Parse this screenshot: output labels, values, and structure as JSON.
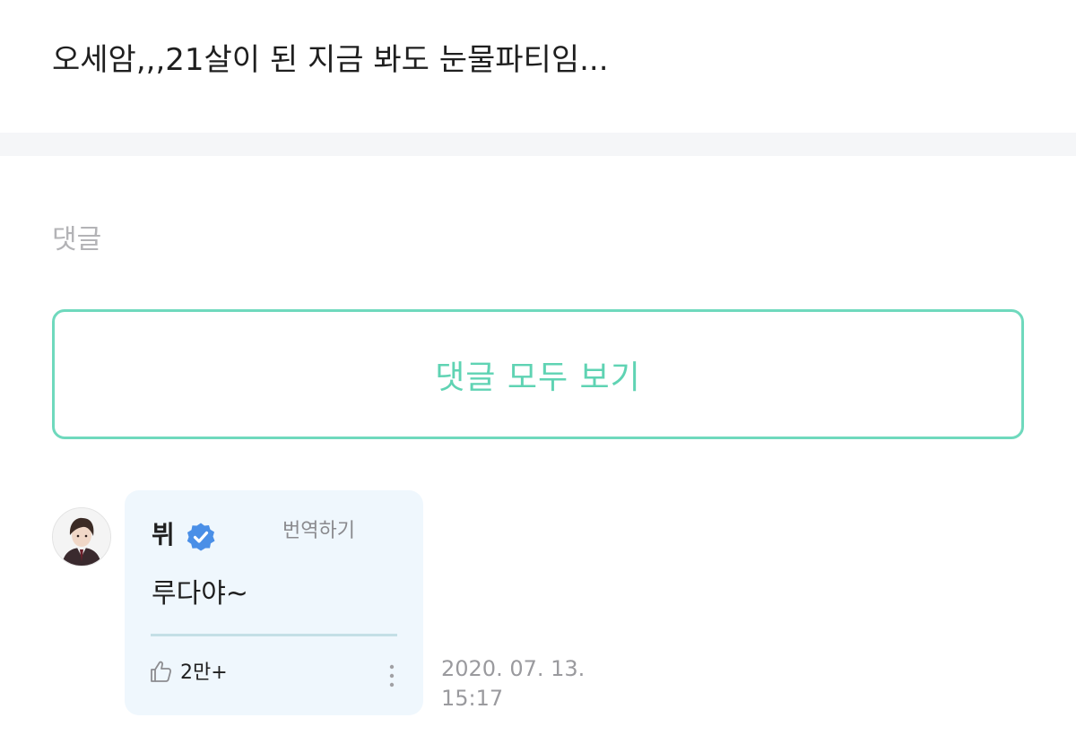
{
  "post": {
    "text": "오세암,,,21살이 된 지금 봐도 눈물파티임..."
  },
  "comments": {
    "section_label": "댓글",
    "view_all_label": "댓글 모두 보기"
  },
  "comment": {
    "author": "뷔",
    "translate_label": "번역하기",
    "text": "루다야~",
    "likes": "2만+",
    "date": "2020. 07. 13.",
    "time": "15:17"
  },
  "icons": {
    "verified": "verified-badge-icon",
    "like": "thumbs-up-icon",
    "more": "vertical-dots-icon"
  },
  "colors": {
    "accent": "#5fd3b3",
    "verified": "#4a8fe7",
    "bubble": "#eff7fd"
  }
}
